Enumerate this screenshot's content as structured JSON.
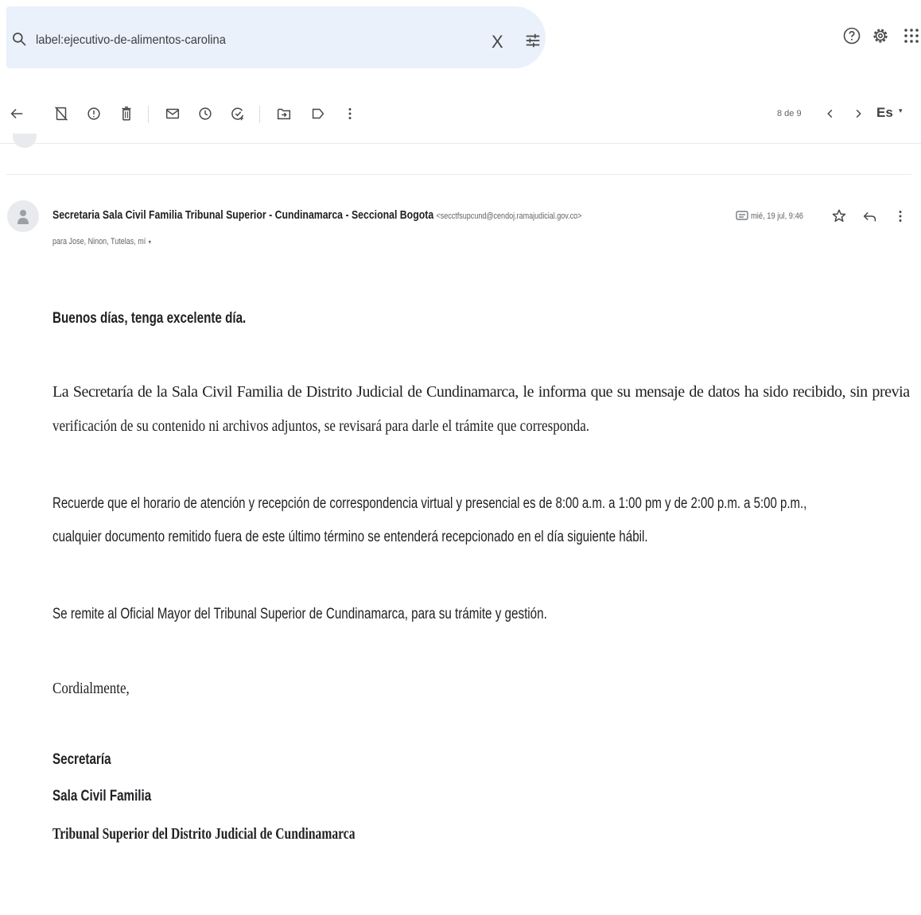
{
  "search": {
    "query": "label:ejecutivo-de-alimentos-carolina",
    "clear_symbol": "X"
  },
  "toolbar": {
    "pager": "8 de 9",
    "language": "Es",
    "language_caret": "▾"
  },
  "message": {
    "sender_name": "Secretaria Sala Civil Familia Tribunal Superior - Cundinamarca - Seccional Bogota",
    "sender_email": "<secctfsupcund@cendoj.ramajudicial.gov.co>",
    "recipients": "para Jose, Ninon, Tutelas, mí",
    "recipients_caret": "▾",
    "date": "mié, 19 jul, 9:46",
    "body": {
      "greeting": "Buenos días, tenga excelente día.",
      "paragraph1_line1": "La Secretaría de la Sala Civil Familia de Distrito Judicial de Cundinamarca, le informa que su mensaje de datos ha sido recibido, sin previa",
      "paragraph1_line2": "verificación de su contenido ni archivos adjuntos, se revisará para darle el trámite que corresponda.",
      "paragraph2_line1": "Recuerde que el horario de atención y recepción de correspondencia virtual y presencial es de 8:00 a.m. a 1:00 pm y de 2:00 p.m. a 5:00 p.m.,",
      "paragraph2_line2": "cualquier documento remitido fuera de este último término se entenderá recepcionado en el día siguiente hábil.",
      "paragraph3": "Se remite al Oficial Mayor del Tribunal Superior de Cundinamarca, para su trámite y gestión.",
      "closing": "Cordialmente,",
      "signature_line1": "Secretaría",
      "signature_line2": "Sala Civil Familia",
      "signature_line3": "Tribunal Superior del Distrito Judicial de Cundinamarca"
    }
  },
  "colors": {
    "search_background": "#eaf1fb",
    "icon": "#444746",
    "text": "#202124",
    "muted_text": "#5f6368",
    "avatar_background": "#e8eaed",
    "avatar_figure": "#9aa0a6"
  }
}
